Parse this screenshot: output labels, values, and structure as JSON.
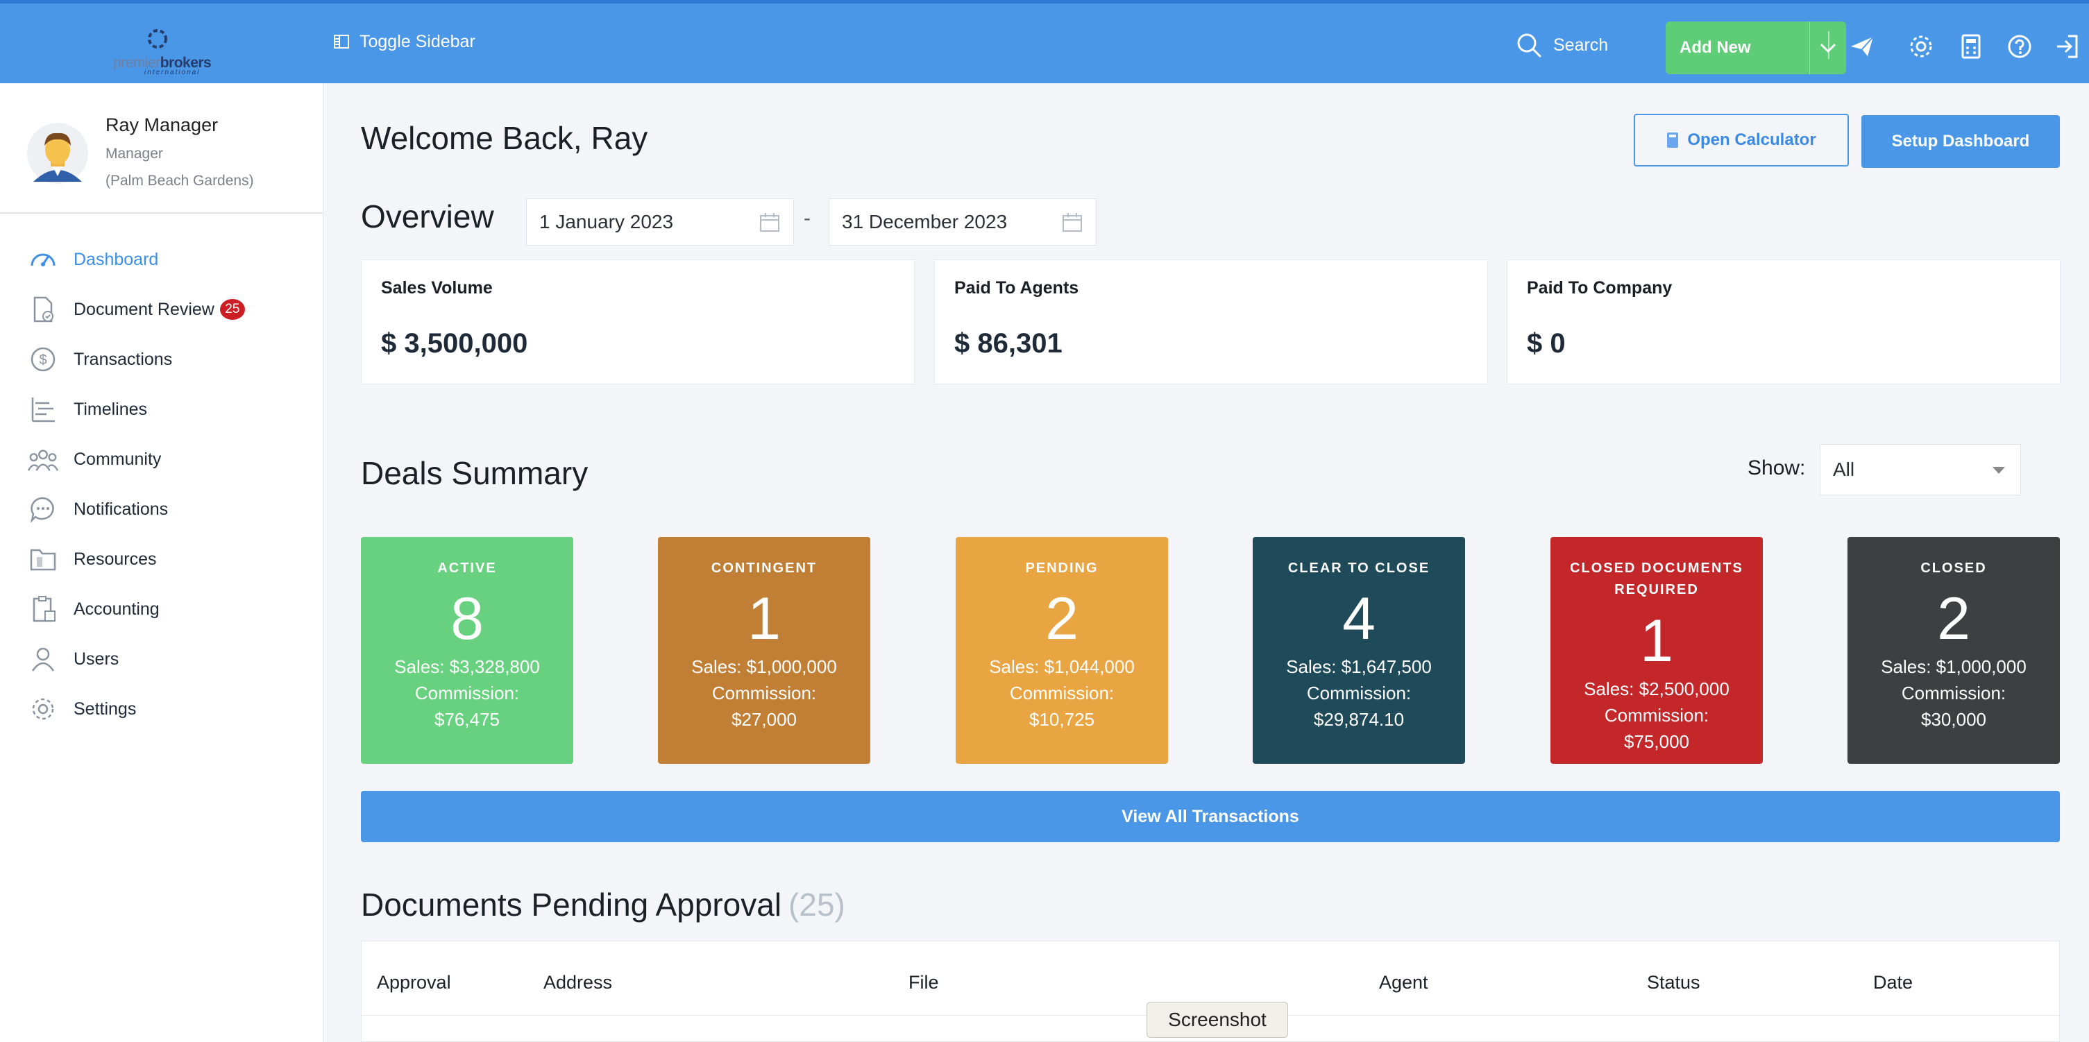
{
  "brand": {
    "logo_main": "premier",
    "logo_bold": "brokers",
    "logo_tag": "international"
  },
  "topbar": {
    "toggle_label": "Toggle Sidebar",
    "search_label": "Search",
    "add_new_label": "Add New",
    "icons": [
      "plane-icon",
      "gear-icon",
      "calculator-icon",
      "help-icon",
      "logout-icon"
    ]
  },
  "user": {
    "name": "Ray Manager",
    "role": "Manager",
    "location": "(Palm Beach Gardens)"
  },
  "sidebar": {
    "items": [
      {
        "label": "Dashboard",
        "icon": "speedometer-icon",
        "active": true
      },
      {
        "label": "Document Review",
        "icon": "document-check-icon",
        "badge": "25"
      },
      {
        "label": "Transactions",
        "icon": "dollar-circle-icon"
      },
      {
        "label": "Timelines",
        "icon": "timeline-icon"
      },
      {
        "label": "Community",
        "icon": "community-icon"
      },
      {
        "label": "Notifications",
        "icon": "chat-bubble-icon"
      },
      {
        "label": "Resources",
        "icon": "folder-icon"
      },
      {
        "label": "Accounting",
        "icon": "clipboard-icon"
      },
      {
        "label": "Users",
        "icon": "user-icon"
      },
      {
        "label": "Settings",
        "icon": "gear-icon"
      }
    ]
  },
  "header": {
    "welcome": "Welcome Back, Ray",
    "calc_button": "Open Calculator",
    "setup_button": "Setup Dashboard"
  },
  "overview": {
    "title": "Overview",
    "date_from": "1 January 2023",
    "date_separator": "-",
    "date_to": "31 December 2023",
    "stats": [
      {
        "title": "Sales Volume",
        "value": "$ 3,500,000"
      },
      {
        "title": "Paid To Agents",
        "value": "$ 86,301"
      },
      {
        "title": "Paid To Company",
        "value": "$ 0"
      }
    ]
  },
  "deals": {
    "title": "Deals Summary",
    "show_label": "Show:",
    "show_value": "All",
    "cards": [
      {
        "label": "ACTIVE",
        "count": "8",
        "sales": "Sales: $3,328,800",
        "commission_label": "Commission:",
        "commission": "$76,475",
        "color": "#68d17f"
      },
      {
        "label": "CONTINGENT",
        "count": "1",
        "sales": "Sales: $1,000,000",
        "commission_label": "Commission:",
        "commission": "$27,000",
        "color": "#c17e35"
      },
      {
        "label": "PENDING",
        "count": "2",
        "sales": "Sales: $1,044,000",
        "commission_label": "Commission:",
        "commission": "$10,725",
        "color": "#e9a541"
      },
      {
        "label": "CLEAR TO CLOSE",
        "count": "4",
        "sales": "Sales: $1,647,500",
        "commission_label": "Commission:",
        "commission": "$29,874.10",
        "color": "#1f4a5a"
      },
      {
        "label": "CLOSED DOCUMENTS REQUIRED",
        "count": "1",
        "sales": "Sales: $2,500,000",
        "commission_label": "Commission:",
        "commission": "$75,000",
        "color": "#c3272a"
      },
      {
        "label": "CLOSED",
        "count": "2",
        "sales": "Sales: $1,000,000",
        "commission_label": "Commission:",
        "commission": "$30,000",
        "color": "#3d3f40"
      }
    ],
    "view_all": "View All Transactions"
  },
  "documents": {
    "title": "Documents Pending Approval",
    "count": "(25)",
    "columns": [
      "Approval",
      "Address",
      "File",
      "Agent",
      "Status",
      "Date"
    ]
  },
  "tooltip": "Screenshot",
  "colors": {
    "primary": "#4a97e8",
    "success": "#5fcc78",
    "badge": "#cc1f25"
  }
}
